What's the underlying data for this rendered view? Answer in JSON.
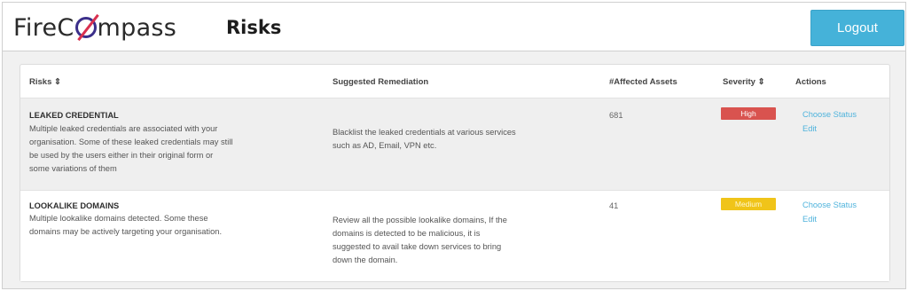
{
  "header": {
    "brand_left": "FireC",
    "brand_right": "mpass",
    "title": "Risks",
    "logout_label": "Logout"
  },
  "table": {
    "columns": [
      "Risks ⇕",
      "Suggested Remediation",
      "#Affected Assets",
      "Severity ⇕",
      "Actions"
    ],
    "rows": [
      {
        "name": "LEAKED CREDENTIAL",
        "description": [
          "Multiple leaked credentials are associated with your",
          "organisation. Some of these leaked credentials may still",
          "be used by the users either in their original form or",
          "some variations of them"
        ],
        "remediation": [
          "Blacklist the leaked credentials at various services",
          "such as AD, Email, VPN etc."
        ],
        "affected": "681",
        "severity": "High",
        "severity_color": "#d9534f",
        "action_status": "Choose Status",
        "action_edit": "Edit"
      },
      {
        "name": "LOOKALIKE DOMAINS",
        "description": [
          "Multiple lookalike domains detected. Some these",
          "domains may be actively targeting your organisation."
        ],
        "remediation": [
          "Review all the possible lookalike domains, If the",
          "domains is detected to be malicious, it is",
          "suggested to avail take down services to bring",
          "down the domain."
        ],
        "affected": "41",
        "severity": "Medium",
        "severity_color": "#f0c419",
        "action_status": "Choose Status",
        "action_edit": "Edit"
      }
    ]
  },
  "colors": {
    "accent": "#45b2d9",
    "link": "#4fb3dc"
  },
  "icons": {
    "logo": "firecompass-logo-icon"
  }
}
